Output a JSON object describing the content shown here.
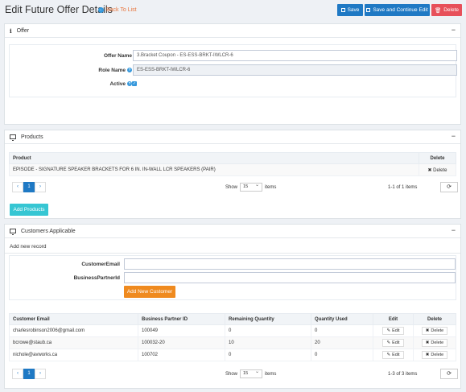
{
  "header": {
    "title": "Edit Future Offer Details",
    "back_label": "Back To List",
    "save_label": "Save",
    "save_continue_label": "Save and Continue Edit",
    "delete_label": "Delete"
  },
  "offer": {
    "panel_title": "Offer",
    "collapse_glyph": "−",
    "offer_name_label": "Offer Name",
    "offer_name_value": "3.Bracket Coupon - ES-ESS-BRKT-IWLCR-6",
    "role_name_label": "Role Name",
    "role_name_value": "ES-ESS-BRKT-IWLCR-6",
    "active_label": "Active",
    "active_checked": true
  },
  "products": {
    "panel_title": "Products",
    "collapse_glyph": "−",
    "columns": [
      "Product",
      "Delete"
    ],
    "rows": [
      {
        "product": "EPISODE - SIGNATURE SPEAKER BRACKETS FOR 6 IN. IN-WALL LCR SPEAKERS (PAIR)",
        "delete": "Delete"
      }
    ],
    "pager": {
      "prev": "‹",
      "page": "1",
      "next": "›"
    },
    "show_label": "Show",
    "page_size": "15",
    "items_label": "items",
    "count_text": "1-1 of 1 items",
    "refresh_glyph": "⟳",
    "add_button": "Add Products"
  },
  "customers": {
    "panel_title": "Customers Applicable",
    "collapse_glyph": "−",
    "add_new_record": "Add new record",
    "customer_email_label": "CustomerEmail",
    "customer_email_value": "",
    "business_partner_label": "BusinessPartnerId",
    "business_partner_value": "",
    "add_customer_button": "Add New Customer",
    "columns": [
      "Customer Email",
      "Business Partner ID",
      "Remaining Quantity",
      "Quantity Used",
      "Edit",
      "Delete"
    ],
    "rows": [
      {
        "email": "charlesrobinson2006@gmail.com",
        "partner": "100049",
        "remaining": "0",
        "used": "0",
        "edit": "Edit",
        "delete": "Delete"
      },
      {
        "email": "bcrowe@staub.ca",
        "partner": "100032-20",
        "remaining": "10",
        "used": "20",
        "edit": "Edit",
        "delete": "Delete"
      },
      {
        "email": "nichole@avworks.ca",
        "partner": "100702",
        "remaining": "0",
        "used": "0",
        "edit": "Edit",
        "delete": "Delete"
      }
    ],
    "pager": {
      "prev": "‹",
      "page": "1",
      "next": "›"
    },
    "show_label": "Show",
    "page_size": "15",
    "items_label": "items",
    "count_text": "1-3 of 3 items",
    "refresh_glyph": "⟳"
  },
  "colors": {
    "primary": "#1f79c4",
    "danger": "#e7505a",
    "info": "#36c6d3",
    "warning": "#ef8a1f"
  }
}
